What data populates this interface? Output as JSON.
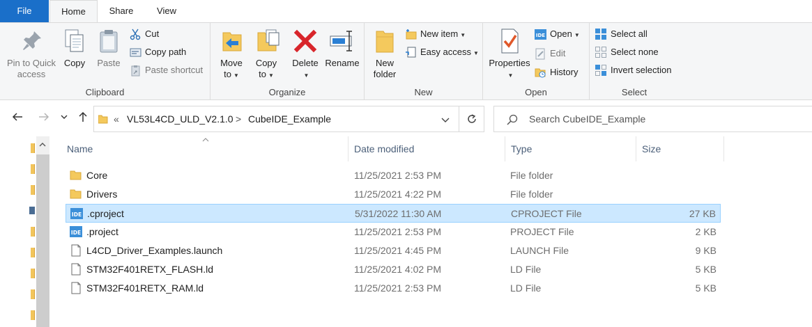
{
  "tabs": {
    "file": "File",
    "home": "Home",
    "share": "Share",
    "view": "View"
  },
  "ribbon": {
    "clipboard": {
      "label": "Clipboard",
      "pin_line1": "Pin to Quick",
      "pin_line2": "access",
      "copy": "Copy",
      "paste": "Paste",
      "cut": "Cut",
      "copy_path": "Copy path",
      "paste_shortcut": "Paste shortcut"
    },
    "organize": {
      "label": "Organize",
      "move_line1": "Move",
      "move_line2": "to",
      "copy_line1": "Copy",
      "copy_line2": "to",
      "delete": "Delete",
      "rename": "Rename"
    },
    "new": {
      "label": "New",
      "folder_line1": "New",
      "folder_line2": "folder",
      "new_item": "New item",
      "easy_access": "Easy access"
    },
    "open": {
      "label": "Open",
      "properties": "Properties",
      "open": "Open",
      "edit": "Edit",
      "history": "History"
    },
    "select": {
      "label": "Select",
      "select_all": "Select all",
      "select_none": "Select none",
      "invert": "Invert selection"
    }
  },
  "address": {
    "overflow": "«",
    "crumb1": "VL53L4CD_ULD_V2.1.0",
    "sep": ">",
    "crumb2": "CubeIDE_Example"
  },
  "search": {
    "placeholder": "Search CubeIDE_Example"
  },
  "columns": {
    "name": "Name",
    "date": "Date modified",
    "type": "Type",
    "size": "Size"
  },
  "files": [
    {
      "name": "Core",
      "date": "11/25/2021 2:53 PM",
      "type": "File folder",
      "size": "",
      "icon": "folder-icon"
    },
    {
      "name": "Drivers",
      "date": "11/25/2021 4:22 PM",
      "type": "File folder",
      "size": "",
      "icon": "folder-icon"
    },
    {
      "name": ".cproject",
      "date": "5/31/2022 11:30 AM",
      "type": "CPROJECT File",
      "size": "27 KB",
      "icon": "ide-file-icon"
    },
    {
      "name": ".project",
      "date": "11/25/2021 2:53 PM",
      "type": "PROJECT File",
      "size": "2 KB",
      "icon": "ide-file-icon"
    },
    {
      "name": "L4CD_Driver_Examples.launch",
      "date": "11/25/2021 4:45 PM",
      "type": "LAUNCH File",
      "size": "9 KB",
      "icon": "document-icon"
    },
    {
      "name": "STM32F401RETX_FLASH.ld",
      "date": "11/25/2021 4:02 PM",
      "type": "LD File",
      "size": "5 KB",
      "icon": "document-icon"
    },
    {
      "name": "STM32F401RETX_RAM.ld",
      "date": "11/25/2021 2:53 PM",
      "type": "LD File",
      "size": "5 KB",
      "icon": "document-icon"
    }
  ],
  "colors": {
    "accent": "#1a6fc9",
    "selection": "#cce8ff",
    "folder": "#f2c55c",
    "delete_red": "#d8252b"
  }
}
